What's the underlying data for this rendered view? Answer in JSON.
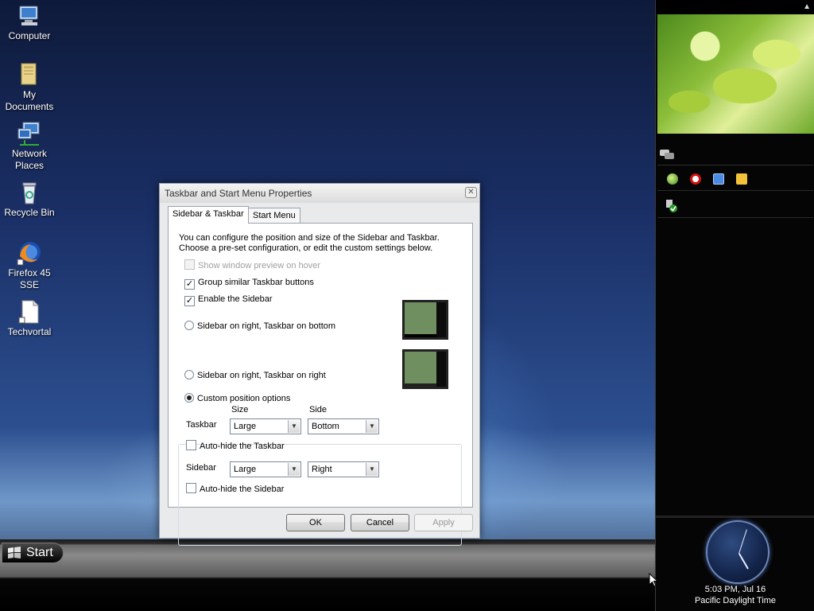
{
  "desktop": {
    "icons": [
      {
        "label": "Computer",
        "icon": "computer-icon"
      },
      {
        "label": "My\nDocuments",
        "icon": "documents-folder-icon"
      },
      {
        "label": "Network\nPlaces",
        "icon": "network-places-icon"
      },
      {
        "label": "Recycle Bin",
        "icon": "recycle-bin-icon"
      },
      {
        "label": "Firefox 45\nSSE",
        "icon": "firefox-icon"
      },
      {
        "label": "Techvortal",
        "icon": "document-shortcut-icon"
      }
    ]
  },
  "dialog": {
    "title": "Taskbar and Start Menu Properties",
    "tabs": [
      "Sidebar & Taskbar",
      "Start Menu"
    ],
    "active_tab": "Sidebar & Taskbar",
    "description": "You can configure the position and size of the Sidebar and Taskbar. Choose a pre-set configuration, or edit the custom settings below.",
    "options": {
      "show_preview": {
        "label": "Show window preview on hover",
        "checked": false,
        "enabled": false
      },
      "group_buttons": {
        "label": "Group similar Taskbar buttons",
        "checked": true
      },
      "enable_sidebar": {
        "label": "Enable the Sidebar",
        "checked": true
      }
    },
    "presets": [
      {
        "label": "Sidebar on right, Taskbar on bottom",
        "selected": false
      },
      {
        "label": "Sidebar on right, Taskbar on right",
        "selected": false
      }
    ],
    "custom": {
      "label": "Custom position options",
      "selected": true,
      "col_size": "Size",
      "col_side": "Side",
      "taskbar_label": "Taskbar",
      "taskbar_size": "Large",
      "taskbar_side": "Bottom",
      "autohide_taskbar": {
        "label": "Auto-hide the Taskbar",
        "checked": false
      },
      "sidebar_label": "Sidebar",
      "sidebar_size": "Large",
      "sidebar_side": "Right",
      "autohide_sidebar": {
        "label": "Auto-hide the Sidebar",
        "checked": false
      }
    },
    "buttons": {
      "ok": "OK",
      "cancel": "Cancel",
      "apply": "Apply"
    }
  },
  "taskbar": {
    "start_label": "Start"
  },
  "sidebar": {
    "clock_time": "5:03 PM, Jul 16",
    "clock_zone": "Pacific Daylight Time",
    "tray_icons": [
      "green-globe-icon",
      "opera-icon",
      "monitor-icon",
      "folder-icon"
    ]
  },
  "colors": {
    "accent": "#1b2f66",
    "sidebar_bg": "#050505"
  }
}
